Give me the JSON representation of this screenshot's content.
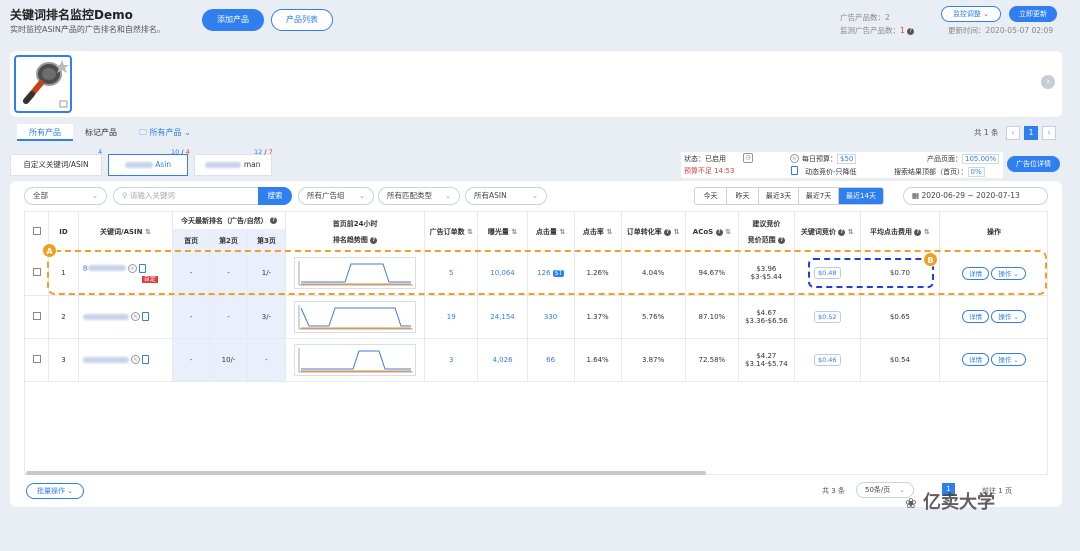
{
  "header": {
    "title": "关键词排名监控Demo",
    "subtitle": "实时监控ASIN产品的广告排名和自然排名。",
    "add_product": "添加产品",
    "product_list": "产品列表",
    "ad_product_count_label": "广告产品数：",
    "ad_product_count": "2",
    "monitored_count_label": "监测广告产品数：",
    "monitored_count": "1",
    "monitor_adjust": "监控调整",
    "refresh_now": "立即更新",
    "update_time_label": "更新时间：",
    "update_time": "2020-05-07 02:09"
  },
  "tabs": {
    "all_products": "所有产品",
    "marked_products": "标记产品",
    "folder": "所有产品",
    "total": "共 1 条",
    "page": "1"
  },
  "keyword_tabs": [
    {
      "label": "自定义关键词/ASIN",
      "badge": "4"
    },
    {
      "label": "Asin",
      "badge_a": "10",
      "badge_b": "4"
    },
    {
      "label": "man",
      "badge_a": "12",
      "badge_b": "7"
    }
  ],
  "status": {
    "status_label": "状态：",
    "status_value": "已启用",
    "budget_warn": "预算不足 14:53",
    "daily_budget_label": "每日预算：",
    "daily_budget": "$50",
    "bid_strategy": "动态竞价-只降低",
    "product_page_label": "产品页面：",
    "product_page": "105.00%",
    "search_top_label": "搜索结果顶部（首页）：",
    "search_top": "0%",
    "ad_detail": "广告位详情"
  },
  "filters": {
    "all": "全部",
    "keyword_placeholder": "请输入关键词",
    "search": "搜索",
    "ad_group": "所有广告组",
    "match_type": "所有匹配类型",
    "asin": "所有ASIN",
    "ranges": [
      "今天",
      "昨天",
      "最近3天",
      "最近7天",
      "最近14天"
    ],
    "active_range": "最近14天",
    "date_start": "2020-06-29",
    "date_sep": "~",
    "date_end": "2020-07-13"
  },
  "table": {
    "headers": {
      "id": "ID",
      "keyword": "关键词/ASIN",
      "today_rank": "今天最新排名（广告/自然）",
      "page1": "首页",
      "page2": "第2页",
      "page3": "第3页",
      "trend_line1": "首页前24小时",
      "trend_line2": "排名趋势图",
      "orders": "广告订单数",
      "impressions": "曝光量",
      "clicks": "点击量",
      "ctr": "点击率",
      "cvr": "订单转化率",
      "acos": "ACoS",
      "bid_line1": "建议竞价",
      "bid_line2": "竞价范围",
      "kw_bid": "关键词竞价",
      "avg_cpc": "平均点击费用",
      "ops": "操作"
    },
    "rows": [
      {
        "id": "1",
        "kw_prefix": "B",
        "tag": "自定",
        "p1": "-",
        "p2": "-",
        "p3": "1/-",
        "orders": "5",
        "impr": "10,064",
        "clicks": "126",
        "st": "ST",
        "ctr": "1.26%",
        "cvr": "4.04%",
        "acos": "94.67%",
        "bid": "$3.96",
        "range": "$3-$5.44",
        "kw_bid": "$0.48",
        "cpc": "$0.70"
      },
      {
        "id": "2",
        "p1": "-",
        "p2": "-",
        "p3": "3/-",
        "orders": "19",
        "impr": "24,154",
        "clicks": "330",
        "ctr": "1.37%",
        "cvr": "5.76%",
        "acos": "87.10%",
        "bid": "$4.67",
        "range": "$3.36-$6.56",
        "kw_bid": "$0.52",
        "cpc": "$0.65"
      },
      {
        "id": "3",
        "p1": "-",
        "p2": "10/-",
        "p3": "-",
        "orders": "3",
        "impr": "4,026",
        "clicks": "66",
        "ctr": "1.64%",
        "cvr": "3.87%",
        "acos": "72.58%",
        "bid": "$4.27",
        "range": "$3.14-$5.74",
        "kw_bid": "$0.46",
        "cpc": "$0.54"
      }
    ],
    "detail": "详情",
    "operate": "操作"
  },
  "footer": {
    "batch": "批量操作",
    "total": "共 3 条",
    "per_page": "50条/页",
    "prev": "前往",
    "page": "1",
    "page_suffix": "页",
    "watermark": "亿卖大学"
  },
  "annotations": {
    "a": "A",
    "b": "B"
  },
  "colors": {
    "accent": "#2f7ff0",
    "highlight": "#f0a020",
    "dash_blue": "#1f3fd8"
  }
}
